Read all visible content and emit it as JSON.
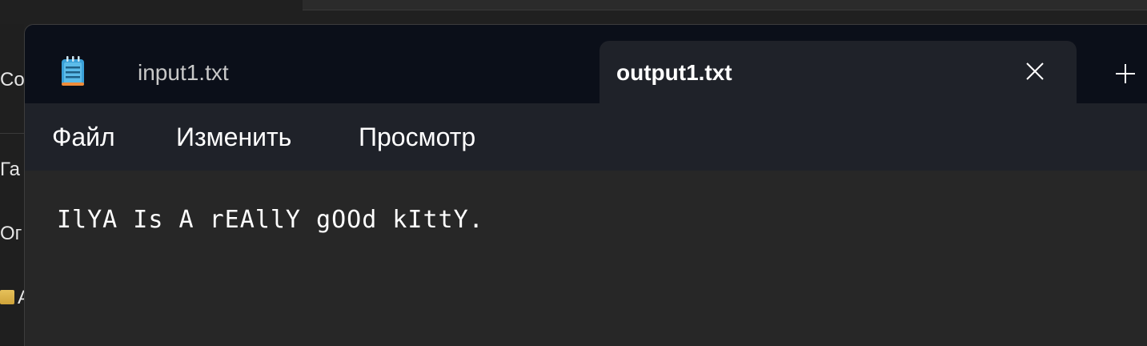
{
  "background": {
    "sidebar_fragments": [
      "Соз",
      "Га",
      "Ог",
      "А"
    ]
  },
  "window": {
    "app_icon": "notepad-icon",
    "tabs": [
      {
        "label": "input1.txt",
        "active": false
      },
      {
        "label": "output1.txt",
        "active": true
      }
    ],
    "close_icon": "close-icon",
    "new_tab_icon": "plus-icon"
  },
  "menu": {
    "items": [
      "Файл",
      "Изменить",
      "Просмотр"
    ]
  },
  "editor": {
    "content": "IlYA Is A rEAllY gOOd kIttY."
  },
  "colors": {
    "titlebar": "#0b0f19",
    "active_tab": "#1f2229",
    "menubar": "#1f2229",
    "editor_bg": "#272727",
    "text": "#ffffff"
  }
}
